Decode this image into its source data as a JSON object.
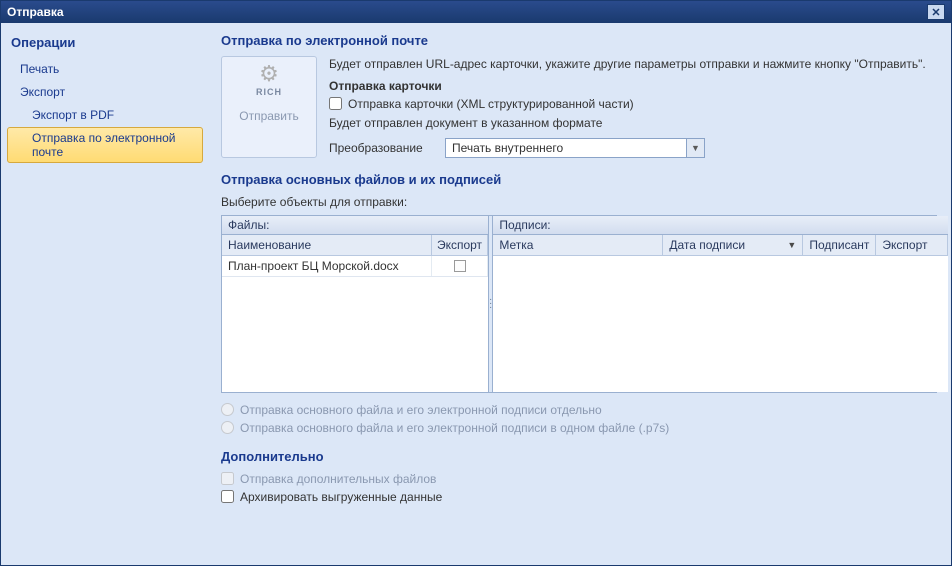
{
  "titlebar": {
    "title": "Отправка"
  },
  "sidebar": {
    "title": "Операции",
    "items": [
      {
        "label": "Печать",
        "level": 1,
        "selected": false
      },
      {
        "label": "Экспорт",
        "level": 1,
        "selected": false
      },
      {
        "label": "Экспорт в PDF",
        "level": 2,
        "selected": false
      },
      {
        "label": "Отправка по электронной почте",
        "level": 2,
        "selected": true
      }
    ]
  },
  "main": {
    "heading": "Отправка по электронной почте",
    "send_button": {
      "rich_label": "RICH",
      "action_label": "Отправить"
    },
    "description": "Будет отправлен URL-адрес карточки, укажите другие параметры отправки и нажмите кнопку \"Отправить\".",
    "card_section_title": "Отправка карточки",
    "card_checkbox_label": "Отправка карточки (XML структурированной части)",
    "format_note": "Будет отправлен документ в указанном формате",
    "transform_label": "Преобразование",
    "transform_value": "Печать внутреннего",
    "files_section_title": "Отправка основных файлов и их подписей",
    "files_instruction": "Выберите объекты для отправки:",
    "files_panel": {
      "title": "Файлы:",
      "columns": {
        "name": "Наименование",
        "export": "Экспорт"
      },
      "rows": [
        {
          "name": "План-проект БЦ Морской.docx",
          "export": false
        }
      ]
    },
    "sigs_panel": {
      "title": "Подписи:",
      "columns": {
        "mark": "Метка",
        "date": "Дата подписи",
        "signer": "Подписант",
        "export": "Экспорт"
      },
      "rows": []
    },
    "radio_options": {
      "separate": "Отправка основного файла и его электронной подписи отдельно",
      "single": "Отправка основного файла и его электронной подписи в одном файле (.p7s)"
    },
    "additional": {
      "title": "Дополнительно",
      "extra_files_label": "Отправка дополнительных файлов",
      "archive_label": "Архивировать выгруженные данные"
    }
  }
}
